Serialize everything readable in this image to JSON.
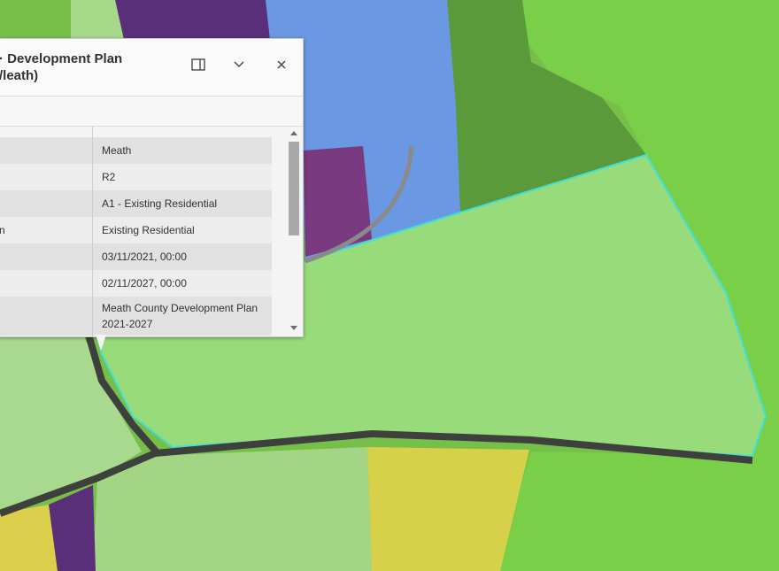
{
  "popup": {
    "title": "· Development Plan\n/leath)",
    "actions": {
      "dock_icon": "dock-icon",
      "collapse_icon": "chevron-down-icon",
      "close_icon": "close-icon"
    },
    "rows": [
      {
        "key": "",
        "value": "Meath"
      },
      {
        "key": "",
        "value": "R2"
      },
      {
        "key": "",
        "value": "A1 - Existing Residential"
      },
      {
        "key": "n",
        "value": "Existing Residential"
      },
      {
        "key": "",
        "value": "03/11/2021, 00:00"
      },
      {
        "key": "",
        "value": "02/11/2027, 00:00"
      },
      {
        "key": "",
        "value": "Meath County Development Plan 2021-2027"
      }
    ]
  },
  "map": {
    "colors": {
      "light_green": "#9bd97e",
      "green": "#78c050",
      "dark_green": "#4d8a35",
      "blue": "#6c98e0",
      "purple": "#5a2f7a",
      "yellow": "#d8d24a",
      "highlight": "#3fe0d8",
      "road": "#3a3f3a"
    }
  }
}
